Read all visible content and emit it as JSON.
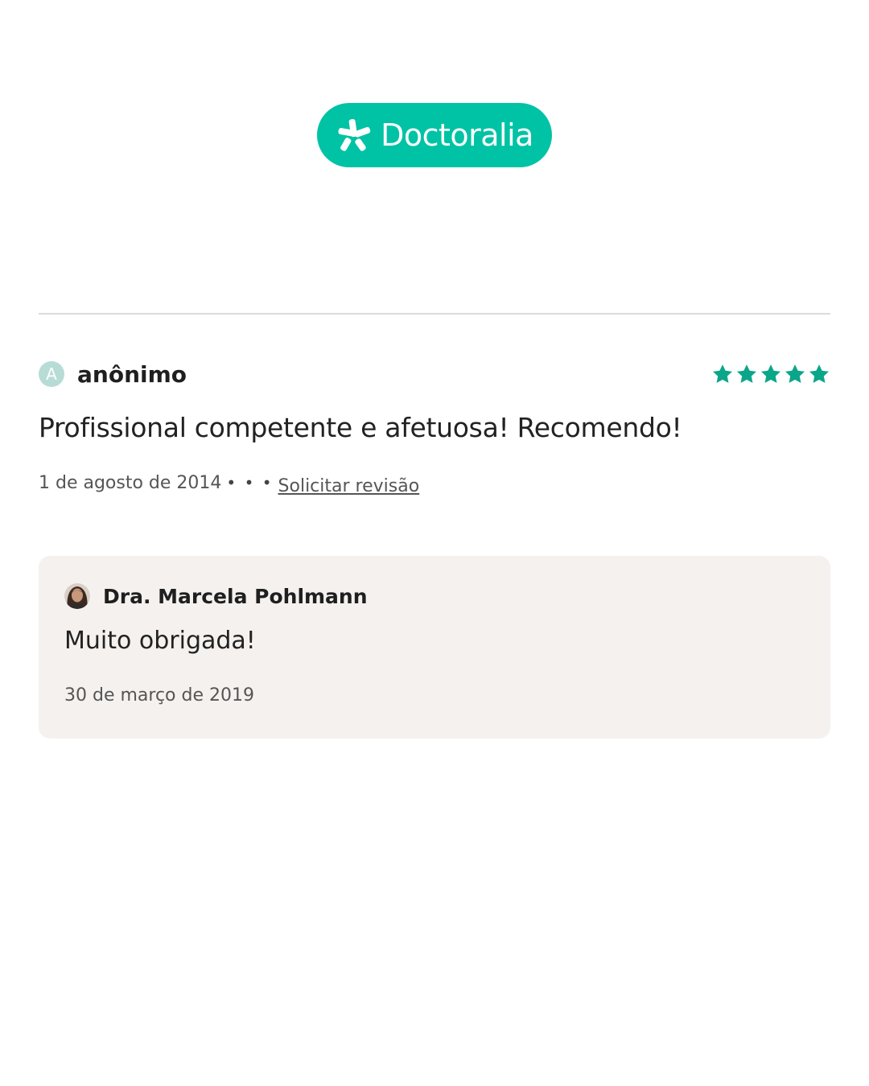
{
  "brand": {
    "name": "Doctoralia",
    "color": "#00c3a5",
    "icon": "doctoralia-star-icon"
  },
  "review": {
    "author_initial": "A",
    "author": "anônimo",
    "rating": 5,
    "rating_max": 5,
    "star_color": "#0ba68a",
    "text": "Profissional competente e afetuosa! Recomendo!",
    "date": "1 de agosto de 2014",
    "separator": "• • •",
    "request_review_label": "Solicitar revisão"
  },
  "reply": {
    "author": "Dra. Marcela Pohlmann",
    "text": "Muito obrigada!",
    "date": "30 de março de 2019",
    "background": "#f5f1ee"
  }
}
